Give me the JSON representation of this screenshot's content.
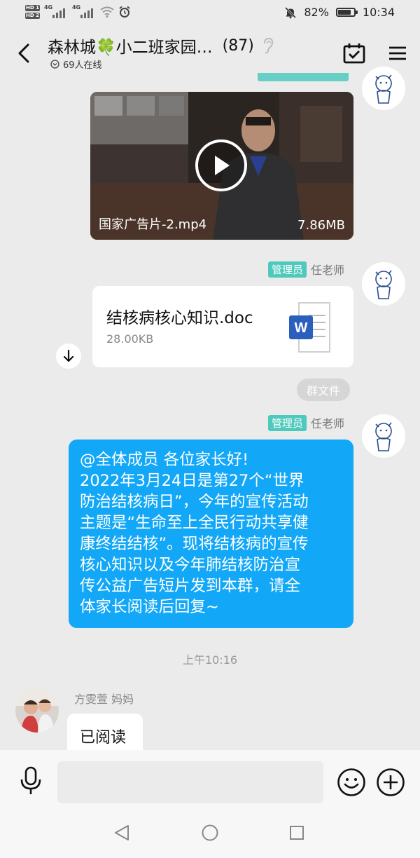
{
  "status_bar": {
    "hd1": "HD 1",
    "hd2": "HD 2",
    "net1": "4G",
    "net2": "4G",
    "battery_text": "82%",
    "battery_level": 0.82,
    "time": "10:34"
  },
  "header": {
    "title": "森林城🍀小二班家园…",
    "member_count": "(87)",
    "online_text": "69人在线"
  },
  "video": {
    "file_name": "国家广告片-2.mp4",
    "file_size": "7.86MB"
  },
  "file_message": {
    "role": "管理员",
    "sender": "任老师",
    "file_name": "结核病核心知识.doc",
    "file_size": "28.00KB",
    "tag": "群文件"
  },
  "text_message": {
    "role": "管理员",
    "sender": "任老师",
    "lines": [
      "@全体成员 各位家长好!",
      "2022年3月24日是第27个“世界",
      "防治结核病日”，今年的宣传活动",
      "主题是“生命至上全民行动共享健",
      "康终结结核”。现将结核病的宣传",
      "核心知识以及今年肺结核防治宣",
      "传公益广告短片发到本群，请全",
      "体家长阅读后回复~"
    ]
  },
  "timestamp": "上午10:16",
  "reply": {
    "sender": "方雯萱  妈妈",
    "text": "已阅读"
  },
  "colors": {
    "bubble_blue": "#12a7f7",
    "admin_badge": "#4fc9bd",
    "background": "#ebebeb"
  },
  "icons": {
    "back": "chevron-left-icon",
    "calendar": "calendar-check-icon",
    "menu": "hamburger-menu-icon",
    "mic": "microphone-icon",
    "emoji": "smiley-icon",
    "plus": "plus-icon"
  }
}
